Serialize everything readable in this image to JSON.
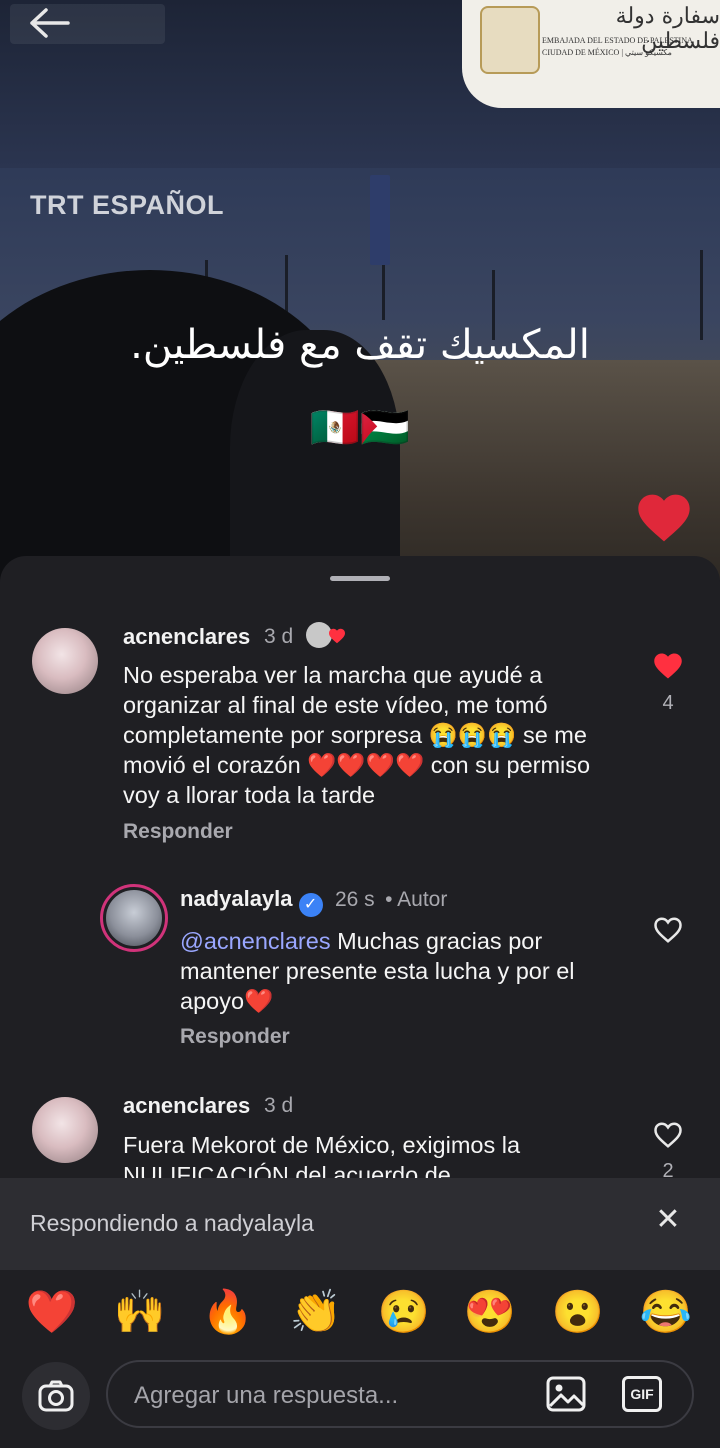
{
  "video": {
    "brand": "TRT ESPAÑOL",
    "headline_arabic": "المكسيك تقف مع فلسطين.",
    "flags": "🇲🇽🇵🇸",
    "embassy_line1": "سفارة دولة فلسطين",
    "embassy_line2": "EMBAJADA DEL ESTADO DE PALESTINA",
    "embassy_line3": "CIUDAD DE MÉXICO | مكسيكو سيتي"
  },
  "comments": [
    {
      "user": "acnenclares",
      "time": "3 d",
      "text": "No esperaba ver la marcha que ayudé a organizar al final de este vídeo, me tomó completamente por sorpresa 😭😭😭 se me movió el corazón ❤️❤️❤️❤️ con su permiso voy a llorar toda la tarde",
      "reply_label": "Responder",
      "likes": "4",
      "liked": true
    },
    {
      "user": "nadyalayla",
      "time": "26 s",
      "author_tag": "• Autor",
      "mention": "@acnenclares",
      "text": " Muchas gracias por mantener presente esta lucha y por el apoyo❤️",
      "reply_label": "Responder"
    },
    {
      "user": "acnenclares",
      "time": "3 d",
      "text": "Fuera Mekorot de México, exigimos la NULIFICACIÓN del acuerdo de",
      "likes": "2"
    }
  ],
  "replying_bar": {
    "label": "Respondiendo a nadyalayla"
  },
  "quick_emojis": [
    "❤️",
    "🙌",
    "🔥",
    "👏",
    "😢",
    "😍",
    "😮",
    "😂"
  ],
  "input": {
    "placeholder": "Agregar una respuesta...",
    "gif_label": "GIF"
  },
  "colors": {
    "like_red": "#ff3040",
    "sheet_bg": "#1f1f23",
    "mention_blue": "#9aa7ff"
  }
}
